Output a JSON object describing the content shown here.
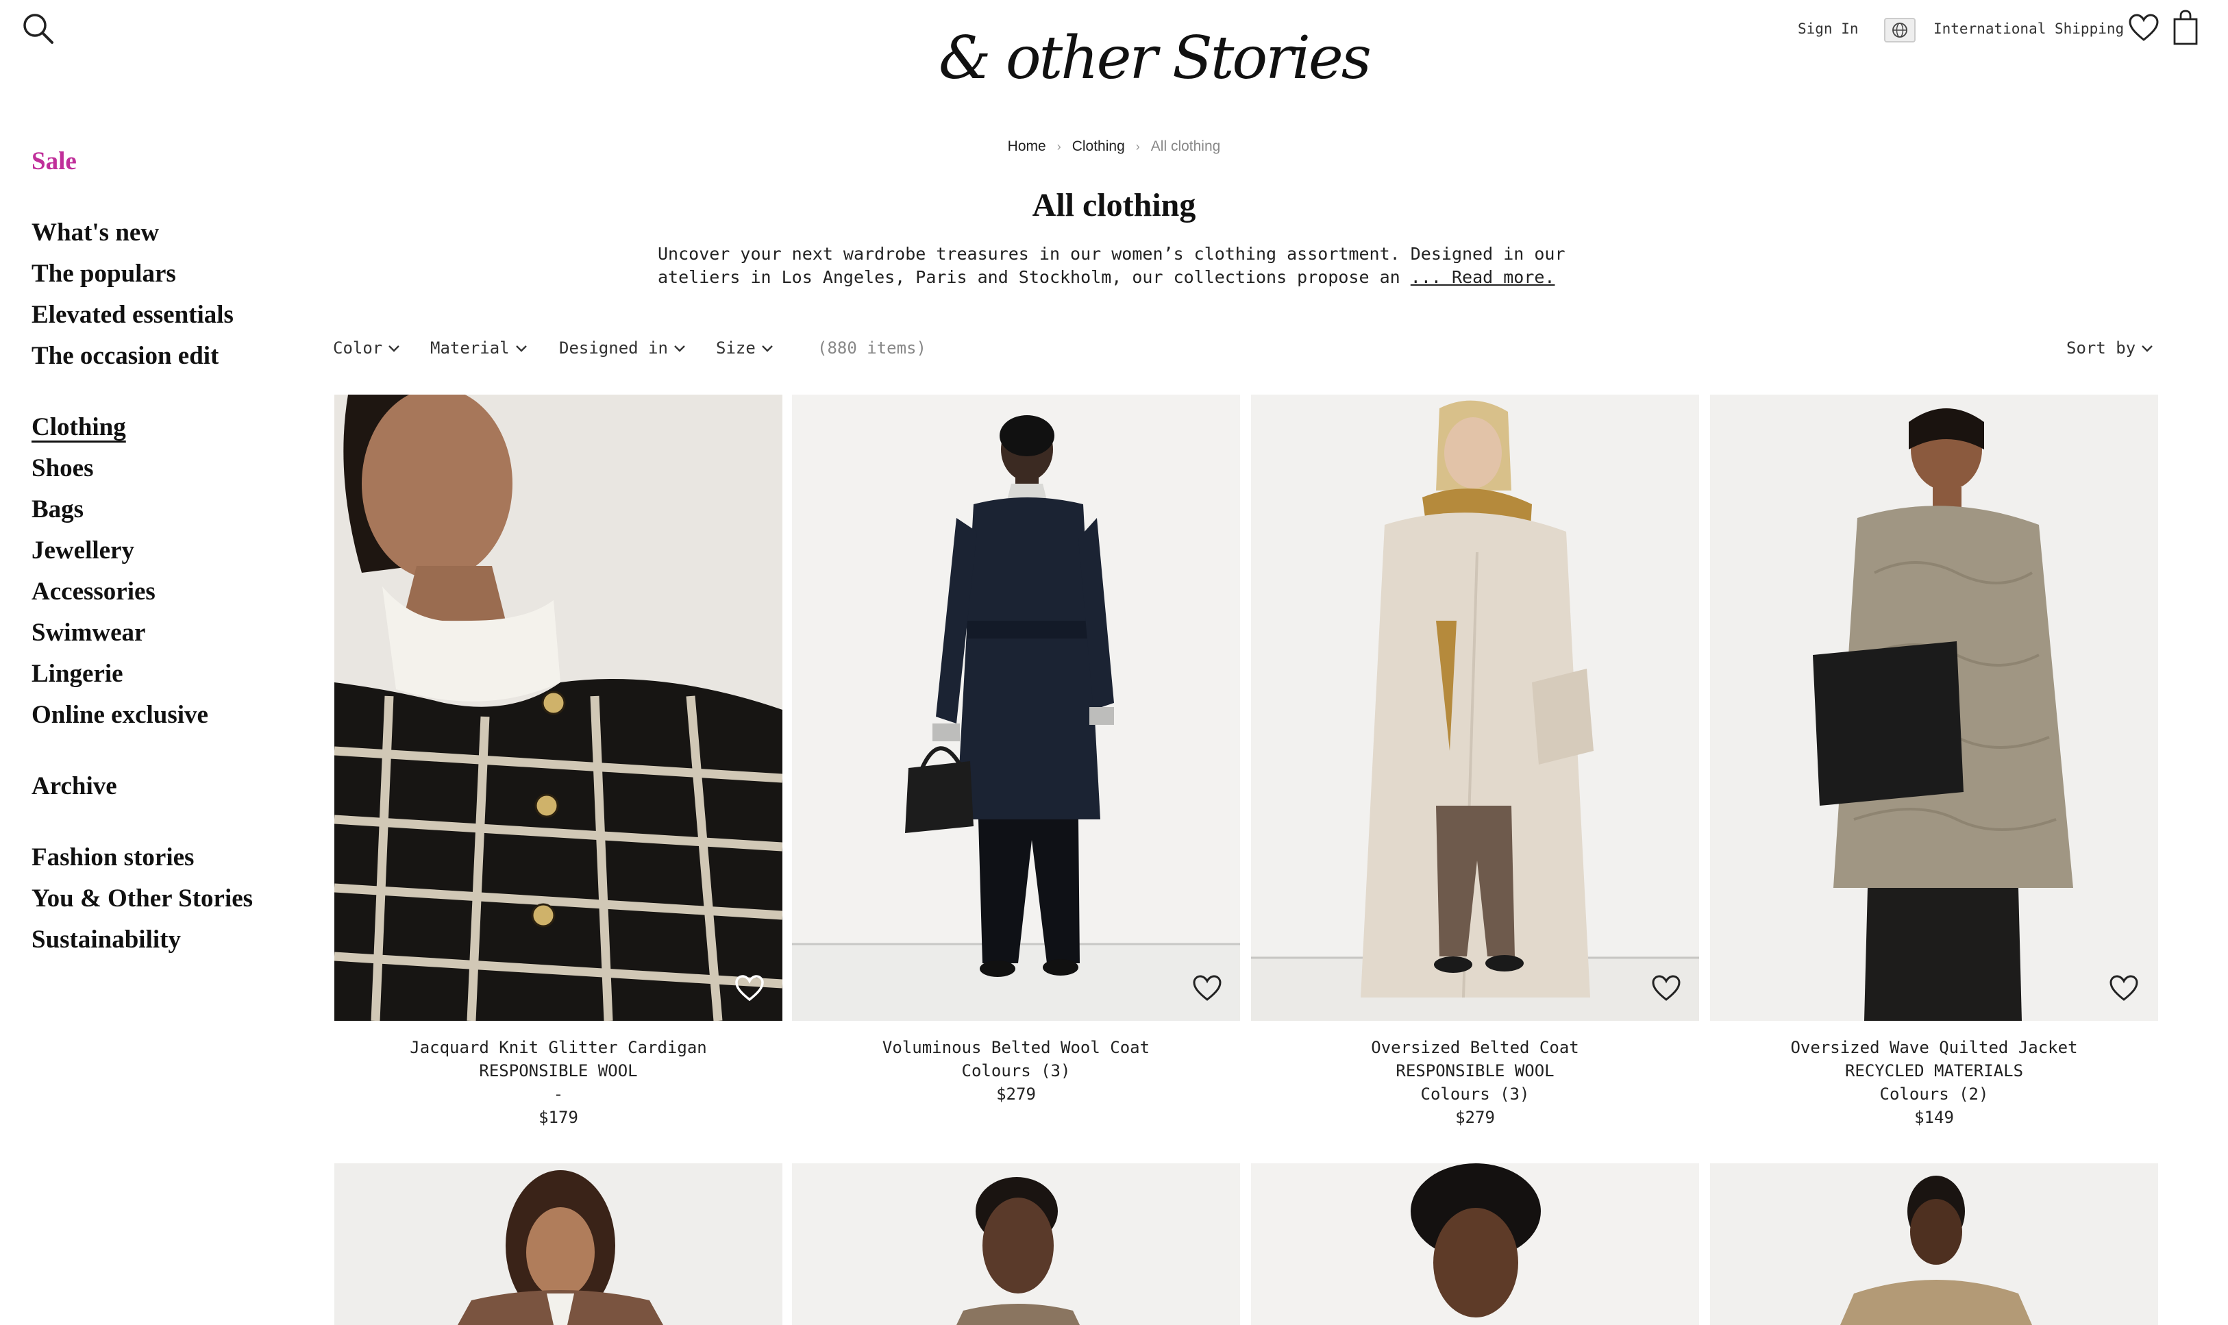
{
  "header": {
    "logo": "& other Stories",
    "sign_in": "Sign In",
    "shipping": "International Shipping"
  },
  "sidebar": {
    "sale": "Sale",
    "group1": [
      "What's new",
      "The populars",
      "Elevated essentials",
      "The occasion edit"
    ],
    "group2": [
      "Clothing",
      "Shoes",
      "Bags",
      "Jewellery",
      "Accessories",
      "Swimwear",
      "Lingerie",
      "Online exclusive"
    ],
    "group3": [
      "Archive"
    ],
    "group4": [
      "Fashion stories",
      "You & Other Stories",
      "Sustainability"
    ]
  },
  "breadcrumb": [
    "Home",
    "Clothing",
    "All clothing"
  ],
  "page": {
    "title": "All clothing",
    "intro_line1": "Uncover your next wardrobe treasures in our women’s clothing assortment. Designed in our",
    "intro_line2": "ateliers in Los Angeles, Paris and Stockholm, our collections propose an",
    "read_more": "... Read more."
  },
  "filters": {
    "items": [
      "Color",
      "Material",
      "Designed in",
      "Size"
    ],
    "count": "(880 items)",
    "sort": "Sort by"
  },
  "products": [
    {
      "name": "Jacquard Knit Glitter Cardigan",
      "line2": "RESPONSIBLE WOOL",
      "line3": "-",
      "price": "$179"
    },
    {
      "name": "Voluminous Belted Wool Coat",
      "line2": "Colours (3)",
      "line3": "",
      "price": "$279"
    },
    {
      "name": "Oversized Belted Coat",
      "line2": "RESPONSIBLE WOOL",
      "line3": "Colours (3)",
      "price": "$279"
    },
    {
      "name": "Oversized Wave Quilted Jacket",
      "line2": "RECYCLED MATERIALS",
      "line3": "Colours (2)",
      "price": "$149"
    }
  ],
  "colors": {
    "sale": "#c02f9a",
    "text": "#111111",
    "muted": "#888888"
  }
}
